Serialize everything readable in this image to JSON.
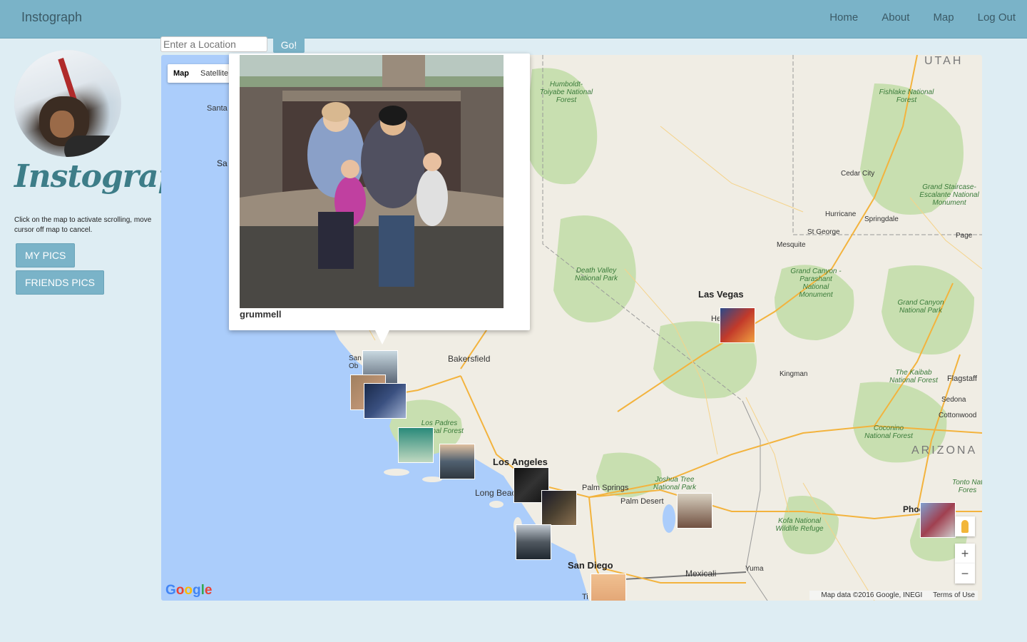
{
  "nav": {
    "brand": "Instograph",
    "links": [
      "Home",
      "About",
      "Map",
      "Log Out"
    ]
  },
  "sidebar": {
    "logo_text": "Instograph",
    "hint": "Click on the map to activate scrolling, move cursor off map to cancel.",
    "my_pics_label": "MY PICS",
    "friends_pics_label": "FRIENDS PICS"
  },
  "search": {
    "placeholder": "Enter a Location",
    "go_label": "Go!"
  },
  "map": {
    "type_map": "Map",
    "type_satellite": "Satellite",
    "zoom_in": "+",
    "zoom_out": "−",
    "attribution": "Map data ©2016 Google, INEGI",
    "terms": "Terms of Use",
    "google": "Google",
    "places": {
      "las_vegas": "Las Vegas",
      "los_angeles": "Los Angeles",
      "san_diego": "San Diego",
      "bakersfield": "Bakersfield",
      "long_beach": "Long Beach",
      "palm_springs": "Palm Springs",
      "palm_desert": "Palm Desert",
      "mexicali": "Mexicali",
      "yuma": "Yuma",
      "kingman": "Kingman",
      "cedar_city": "Cedar City",
      "st_george": "St George",
      "hurricane": "Hurricane",
      "springdale": "Springdale",
      "mesquite": "Mesquite",
      "page": "Page",
      "flagstaff": "Flagstaff",
      "sedona": "Sedona",
      "cottonwood": "Cottonwood",
      "phoenix": "Phoenix",
      "santa": "Santa",
      "sa": "Sa",
      "he": "He",
      "san_ob": "San Ob",
      "ti": "Ti"
    },
    "parks": {
      "humboldt": "Humboldt-Toiyabe National Forest",
      "fishlake": "Fishlake National Forest",
      "grand_staircase": "Grand Staircase-Escalante National Monument",
      "death_valley": "Death Valley National Park",
      "parashant": "Grand Canyon - Parashant National Monument",
      "grand_canyon": "Grand Canyon National Park",
      "kaibab": "The Kaibab National Forest",
      "coconino": "Coconino National Forest",
      "los_padres": "Los Padres National Forest",
      "joshua_tree": "Joshua Tree National Park",
      "kofa": "Kofa National Wildlife Refuge",
      "tonto": "Tonto Nat Fores"
    },
    "states": {
      "utah": "UTAH",
      "arizona": "ARIZONA"
    }
  },
  "infowindow": {
    "username": "grummell"
  }
}
